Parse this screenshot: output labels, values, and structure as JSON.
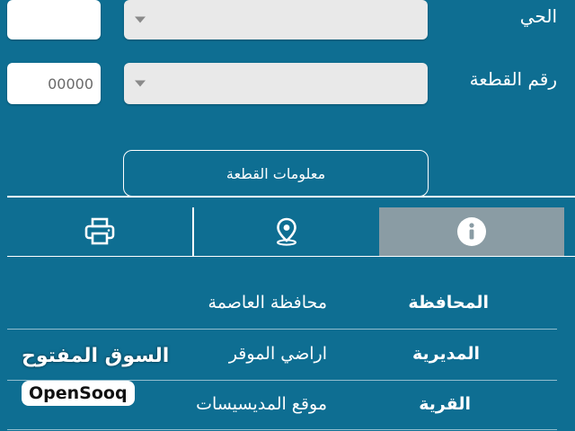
{
  "form": {
    "neighborhood": {
      "label": "الحي",
      "value": ""
    },
    "plot_number": {
      "label": "رقم القطعة",
      "placeholder": "00000"
    },
    "info_button": "معلومات القطعة"
  },
  "tabs": [
    {
      "icon": "info-icon",
      "active": true
    },
    {
      "icon": "location-pin-icon",
      "active": false
    },
    {
      "icon": "printer-icon",
      "active": false
    }
  ],
  "details": [
    {
      "label": "المحافظة",
      "value": "محافظة العاصمة"
    },
    {
      "label": "المديرية",
      "value": "اراضي الموقر"
    },
    {
      "label": "القرية",
      "value": "موقع المديسيسات"
    }
  ],
  "watermark": {
    "arabic": "السوق المفتوح",
    "english": "OpenSooq"
  },
  "colors": {
    "background": "#0e6e92",
    "active_tab": "#8a9ca4",
    "select": "#e9e9e9"
  }
}
